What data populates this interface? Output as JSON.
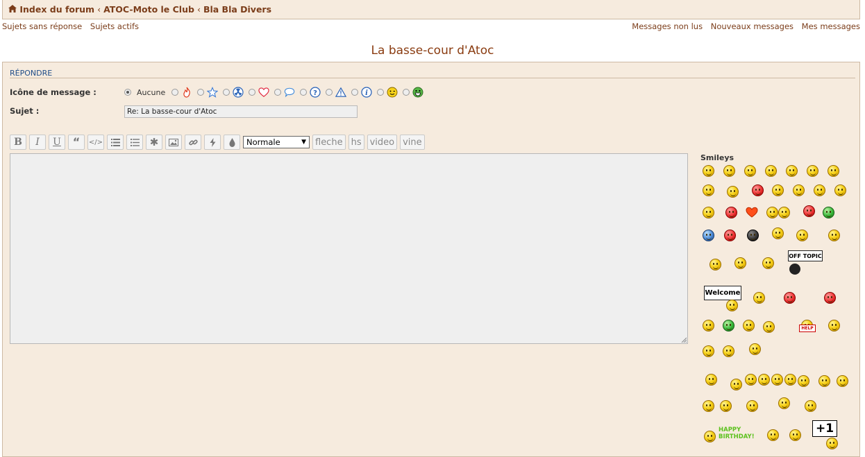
{
  "breadcrumb": {
    "items": [
      "Index du forum",
      "ATOC-Moto le Club",
      "Bla Bla Divers"
    ]
  },
  "links_left": [
    "Sujets sans réponse",
    "Sujets actifs"
  ],
  "links_right": [
    "Messages non lus",
    "Nouveaux messages",
    "Mes messages"
  ],
  "page_title": "La basse-cour d'Atoc",
  "form": {
    "section_title": "RÉPONDRE",
    "icon_label": "Icône de message :",
    "icon_none": "Aucune",
    "subject_label": "Sujet :",
    "subject_value": "Re: La basse-cour d'Atoc",
    "font_size_selected": "Normale",
    "custom_buttons": [
      "fleche",
      "hs",
      "video",
      "vine"
    ]
  },
  "smileys": {
    "title": "Smileys",
    "sign_offtopic": "OFF TOPIC",
    "sign_welcome": "Welcome",
    "sign_help": "HELP",
    "birthday_line1": "HAPPY",
    "birthday_line2": "BIRTHDAY!",
    "plus_one": "+1"
  }
}
